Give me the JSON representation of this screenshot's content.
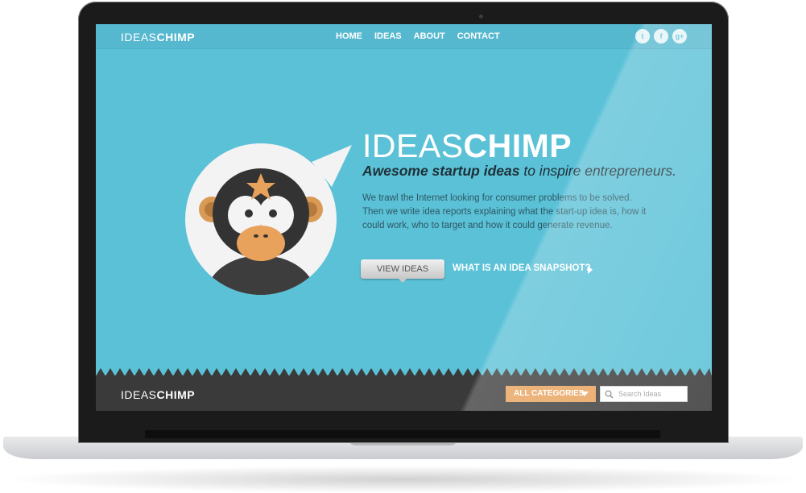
{
  "brand": {
    "logo_light": "IDEAS",
    "logo_bold": "CHIMP"
  },
  "nav": {
    "items": [
      "HOME",
      "IDEAS",
      "ABOUT",
      "CONTACT"
    ]
  },
  "social": {
    "twitter": "t",
    "facebook": "f",
    "google_plus": "g+"
  },
  "hero": {
    "title_light": "IDEAS",
    "title_bold": "CHIMP",
    "tagline_bold": "Awesome startup ideas",
    "tagline_rest": " to inspire entrepreneurs.",
    "description_line1": "We trawl the Internet looking for consumer problems to be solved.",
    "description_line2": "Then  we write idea reports explaining what the start-up idea is, how it",
    "description_line3": "could work, who to target and how it could generate revenue.",
    "view_ideas_label": "VIEW IDEAS",
    "snapshot_label": "WHAT IS AN IDEA SNAPSHOT?"
  },
  "footer": {
    "categories_label": "ALL CATEGORIES",
    "search_placeholder": "Search Ideas"
  },
  "colors": {
    "hero_bg": "#5ac1d7",
    "footer_bg": "#3a3a3a",
    "accent_orange": "#e8a25b"
  }
}
